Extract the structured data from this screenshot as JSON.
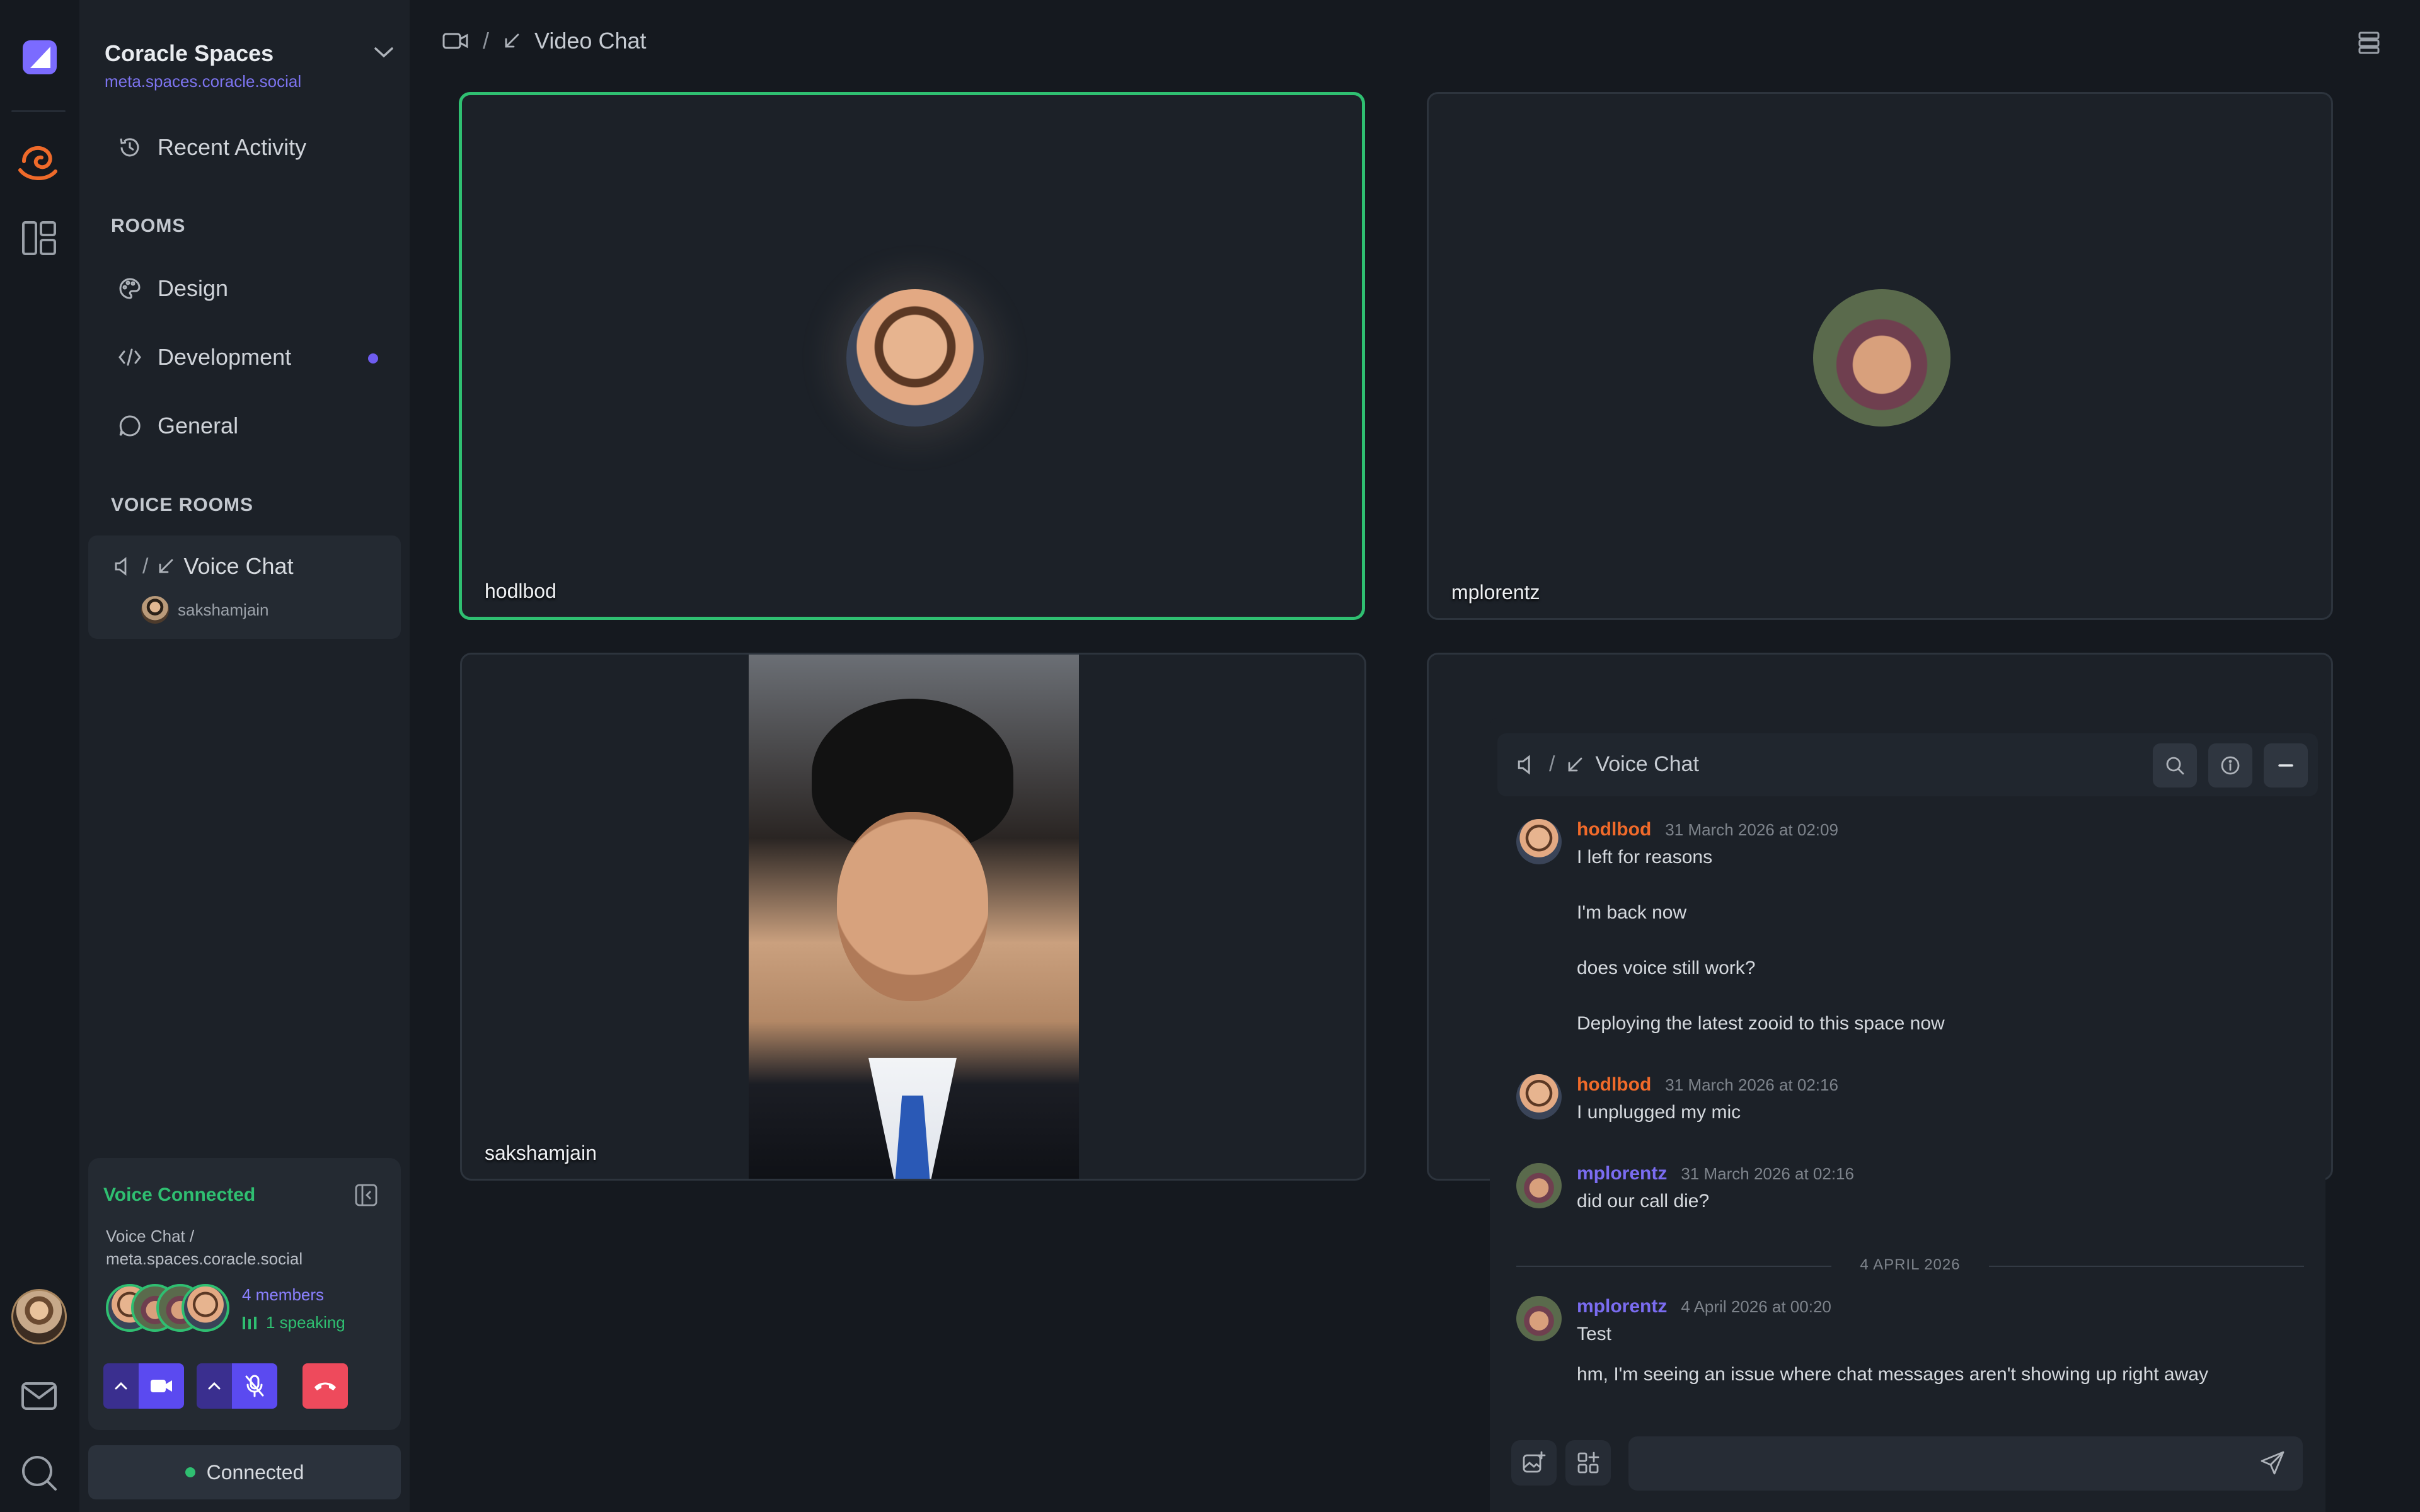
{
  "space": {
    "name": "Coracle Spaces",
    "url": "meta.spaces.coracle.social"
  },
  "nav": {
    "recent_activity": "Recent Activity",
    "rooms_title": "ROOMS",
    "rooms": [
      {
        "label": "Design",
        "icon": "palette-icon",
        "unread": false
      },
      {
        "label": "Development",
        "icon": "code-icon",
        "unread": true
      },
      {
        "label": "General",
        "icon": "chat-bubble-icon",
        "unread": false
      }
    ],
    "voice_rooms_title": "VOICE ROOMS",
    "voice_room": {
      "slash": "/",
      "label": "Voice Chat",
      "participant": "sakshamjain"
    }
  },
  "voice_panel": {
    "title": "Voice Connected",
    "subtitle_line1": "Voice Chat /",
    "subtitle_line2": "meta.spaces.coracle.social",
    "members": "4 members",
    "speaking": "1 speaking"
  },
  "connected_button": "Connected",
  "header": {
    "slash": "/",
    "title": "Video Chat"
  },
  "tiles": [
    {
      "name": "hodlbod",
      "active": true
    },
    {
      "name": "mplorentz",
      "active": false
    },
    {
      "name": "sakshamjain",
      "active": false
    }
  ],
  "chat": {
    "slash": "/",
    "title": "Voice Chat",
    "groups": [
      {
        "user": "hodlbod",
        "time": "31 March 2026 at 02:09",
        "messages": [
          "I left for reasons",
          "I'm back now",
          "does voice still work?",
          "Deploying the latest zooid to this space now"
        ]
      },
      {
        "user": "hodlbod",
        "time": "31 March 2026 at 02:16",
        "messages": [
          "I unplugged my mic"
        ]
      },
      {
        "user": "mplorentz",
        "time": "31 March 2026 at 02:16",
        "messages": [
          "did our call die?"
        ]
      },
      {
        "user": "mplorentz",
        "time": "4 April 2026 at 00:20",
        "messages": [
          "Test",
          "hm, I'm seeing an issue where chat messages aren't showing up right away"
        ]
      }
    ],
    "date_separator": "4 APRIL 2026",
    "composer_value": ""
  },
  "colors": {
    "accent": "#5b4af0",
    "online": "#2fbf71",
    "hangup": "#ee4a5c",
    "user_orange": "#f06a2a",
    "user_purple": "#7a6cf0"
  }
}
